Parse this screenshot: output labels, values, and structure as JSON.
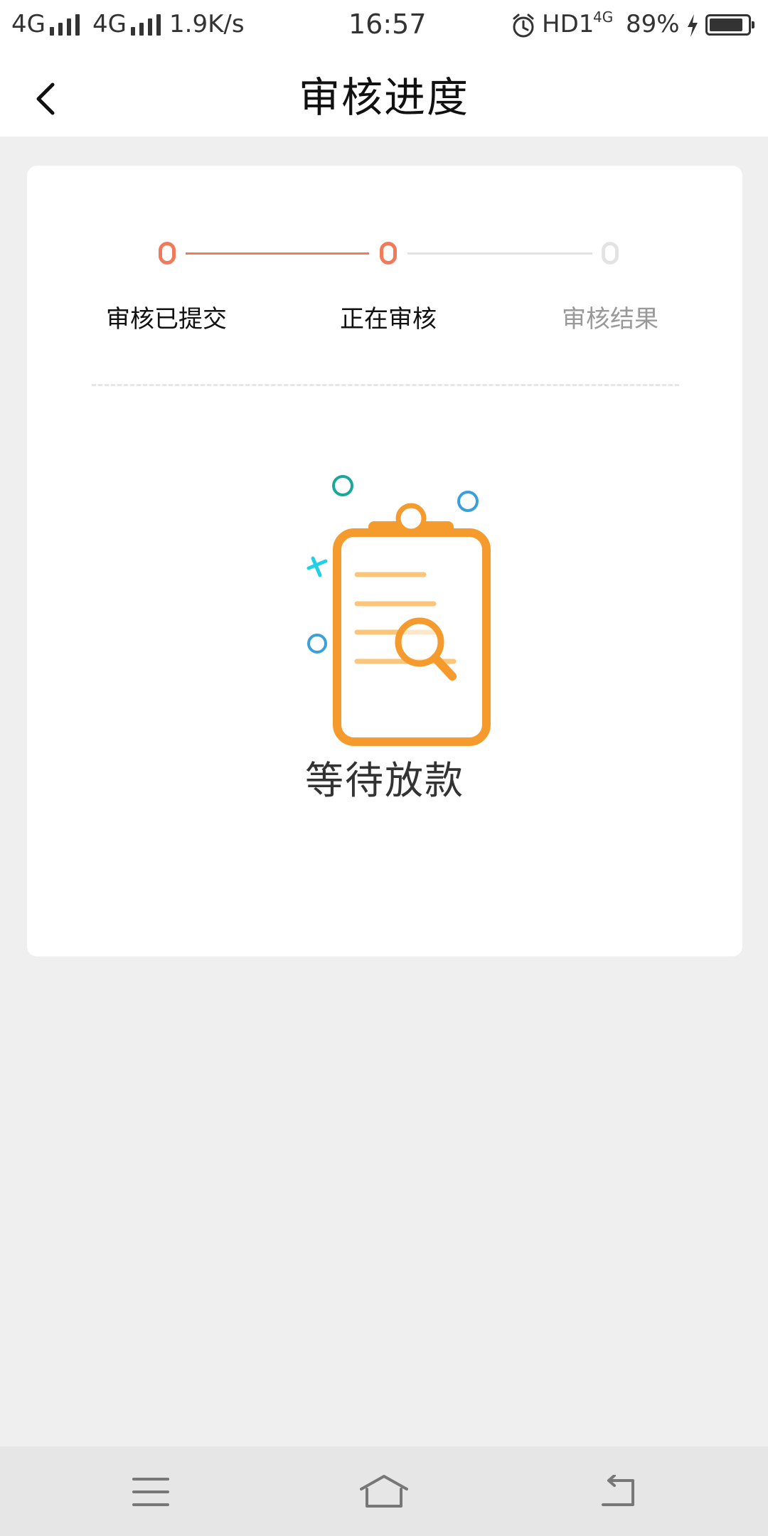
{
  "status_bar": {
    "signal1": "4G",
    "signal2": "4G",
    "speed": "1.9K/s",
    "time": "16:57",
    "hd": "HD1",
    "net_small": "4G",
    "battery_percent": "89%",
    "battery_level": 0.89
  },
  "header": {
    "title": "审核进度",
    "back_icon": "chevron-left-icon"
  },
  "progress": {
    "steps": [
      {
        "label": "审核已提交",
        "state": "done"
      },
      {
        "label": "正在审核",
        "state": "active"
      },
      {
        "label": "审核结果",
        "state": "pending"
      }
    ],
    "active_color": "#f07a5a",
    "inactive_color": "#e3e3e3",
    "inactive_text_color": "#999999"
  },
  "content": {
    "illustration_icon": "clipboard-search-icon",
    "status_text": "等待放款"
  },
  "navbar": {
    "menu_icon": "menu-icon",
    "home_icon": "home-icon",
    "back_icon": "back-icon"
  }
}
